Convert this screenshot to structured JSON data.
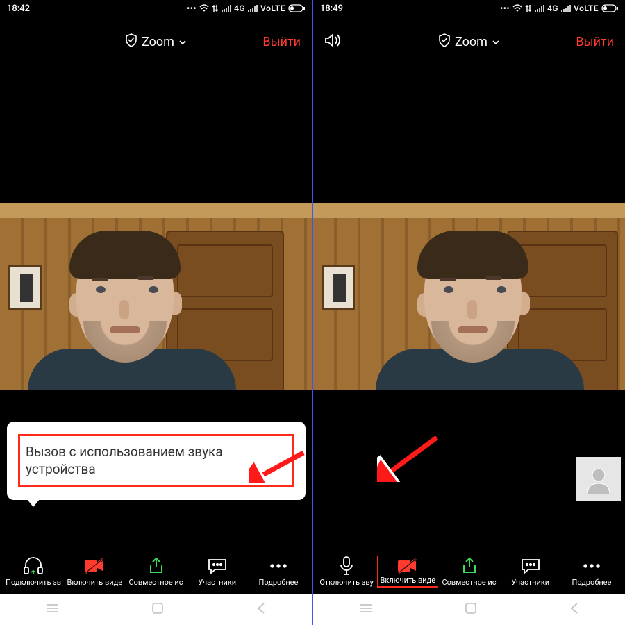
{
  "left": {
    "statusbar": {
      "time": "18:42",
      "net": "4G",
      "volte": "VoLTE"
    },
    "header": {
      "title": "Zoom",
      "leave": "Выйти"
    },
    "popup": {
      "text": "Вызов с использованием звука устройства"
    },
    "toolbar": {
      "audio": "Подключить зв",
      "video": "Включить виде",
      "share": "Совместное ис",
      "participants": "Участники",
      "more": "Подробнее"
    }
  },
  "right": {
    "statusbar": {
      "time": "18:49",
      "net": "4G",
      "volte": "VoLTE"
    },
    "header": {
      "title": "Zoom",
      "leave": "Выйти"
    },
    "toolbar": {
      "audio": "Отключить зву",
      "video": "Включить виде",
      "share": "Совместное ис",
      "participants": "Участники",
      "more": "Подробнее"
    }
  }
}
